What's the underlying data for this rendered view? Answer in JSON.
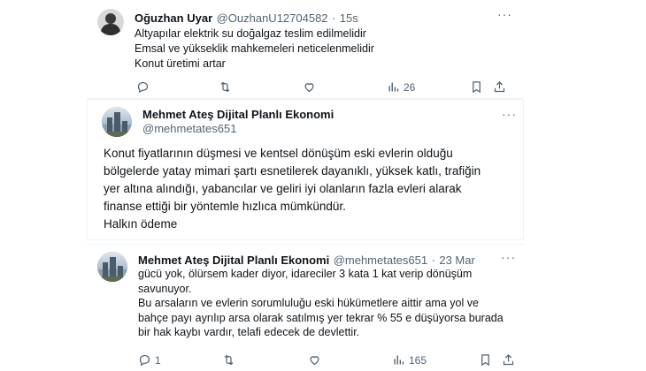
{
  "tweet1": {
    "name": "Oğuzhan Uyar",
    "handle": "@OuzhanU12704582",
    "time": "15s",
    "lines": [
      "Altyapılar elektrik su doğalgaz teslim edilmelidir",
      "Emsal ve yükseklik mahkemeleri neticelenmelidir",
      "Konut üretimi artar"
    ],
    "views": "26",
    "icons": [
      "reply-icon",
      "retweet-icon",
      "like-icon",
      "views-icon",
      "bookmark-icon",
      "share-icon"
    ]
  },
  "tweet2": {
    "name": "Mehmet Ateş Dijital Planlı Ekonomi",
    "handle": "@mehmetates651",
    "lines": [
      "Konut fiyatlarının düşmesi ve kentsel dönüşüm eski evlerin olduğu",
      "bölgelerde yatay mimari şartı esnetilerek dayanıklı, yüksek katlı, trafiğin",
      "yer altına alındığı, yabancılar ve geliri iyi olanların fazla evleri alarak",
      "finanse ettiği bir yöntemle hızlıca mümkündür.",
      "Halkın ödeme"
    ]
  },
  "tweet3": {
    "name": "Mehmet Ateş Dijital Planlı Ekonomi",
    "handle": "@mehmetates651",
    "time": "23 Mar",
    "lines": [
      "gücü yok, ölürsem kader diyor, idareciler 3 kata 1 kat verip dönüşüm",
      "savunuyor.",
      "Bu arsaların ve evlerin sorumluluğu eski hükümetlere aittir ama yol ve",
      "bahçe payı ayrılıp arsa olarak satılmış yer tekrar % 55 e düşüyorsa burada",
      "bir hak kaybı vardır, telafi edecek de devlettir."
    ],
    "replies": "1",
    "views": "165"
  }
}
